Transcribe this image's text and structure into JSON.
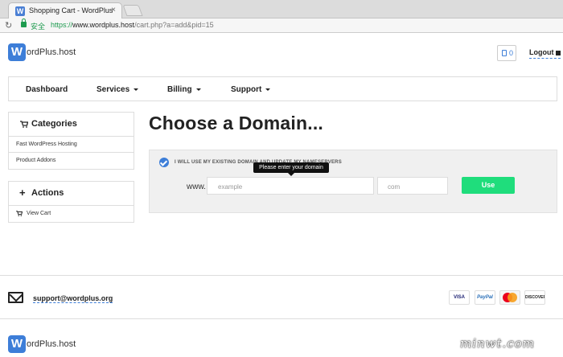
{
  "browser": {
    "tab_title": "Shopping Cart - WordPlus",
    "tab_icon": "W",
    "secure_label": "安全",
    "url_protocol": "https://",
    "url_host": "www.wordplus.host",
    "url_path": "/cart.php?a=add&pid=15"
  },
  "header": {
    "logo_letter": "W",
    "logo_text": "ordPlus.host",
    "cart_count": "0",
    "logout_label": "Logout"
  },
  "nav": {
    "items": [
      {
        "label": "Dashboard",
        "dropdown": false
      },
      {
        "label": "Services",
        "dropdown": true
      },
      {
        "label": "Billing",
        "dropdown": true
      },
      {
        "label": "Support",
        "dropdown": true
      }
    ]
  },
  "sidebar": {
    "categories": {
      "title": "Categories",
      "items": [
        "Fast WordPress Hosting",
        "Product Addons"
      ]
    },
    "actions": {
      "title": "Actions",
      "items": [
        "View Cart"
      ]
    }
  },
  "main": {
    "title": "Choose a Domain...",
    "option_label": "I WILL USE MY EXISTING DOMAIN AND UPDATE MY NAMESERVERS",
    "tooltip": "Please enter your domain",
    "www_label": "www.",
    "sld_placeholder": "example",
    "tld_placeholder": "com",
    "use_button": "Use"
  },
  "footer": {
    "support_email": "support@wordplus.org",
    "payment_methods": [
      "VISA",
      "PayPal",
      "MasterCard",
      "DISCOVER"
    ],
    "logo_letter": "W",
    "logo_text": "ordPlus.host"
  },
  "watermark": "minwt.com",
  "colors": {
    "accent": "#3d7ed8",
    "use_button": "#1fdd7c",
    "secure_green": "#1e9b4f"
  }
}
